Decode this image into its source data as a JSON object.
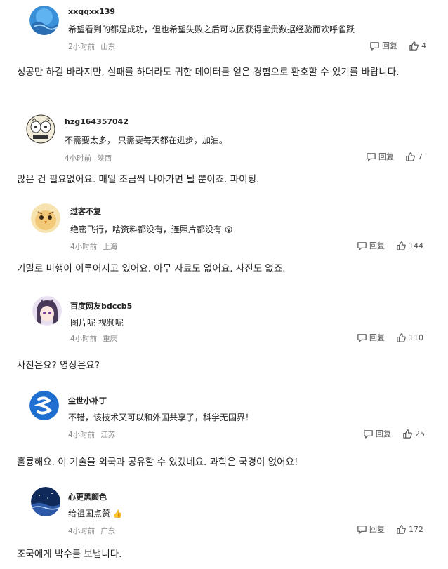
{
  "comments": [
    {
      "username": "xxqqxx139",
      "text": "希望看到的都是成功，但也希望失败之后可以因获得宝贵数据经验而欢呼雀跃",
      "time": "2小时前",
      "location": "山东",
      "reply_label": "回复",
      "likes": "4",
      "translation": "성공만 하길 바라지만, 실패를 하더라도 귀한 데이터를 얻은 경험으로 환호할 수 있기를 바랍니다."
    },
    {
      "username": "hzg164357042",
      "text": "不需要太多， 只需要每天都在进步，加油。",
      "time": "4小时前",
      "location": "陕西",
      "reply_label": "回复",
      "likes": "7",
      "translation": "많은 건 필요없어요. 매일 조금씩 나아가면 될 뿐이죠. 파이팅."
    },
    {
      "username": "过客不复",
      "text": "绝密飞行，啥资料都没有，连照片都没有",
      "emoji": "😮",
      "time": "4小时前",
      "location": "上海",
      "reply_label": "回复",
      "likes": "144",
      "translation": "기밀로 비행이 이루어지고 있어요. 아무 자료도 없어요. 사진도 없죠."
    },
    {
      "username": "百度网友bdccb5",
      "text": "图片呢 视频呢",
      "time": "4小时前",
      "location": "重庆",
      "reply_label": "回复",
      "likes": "110",
      "translation": "사진은요? 영상은요?"
    },
    {
      "username": "尘世小补丁",
      "text": "不错，该技术又可以和外国共享了，科学无国界！",
      "time": "4小时前",
      "location": "江苏",
      "reply_label": "回复",
      "likes": "25",
      "translation": "훌륭해요. 이 기술을 외국과 공유할 수 있겠네요. 과학은 국경이 없어요!"
    },
    {
      "username": "心更黑颜色",
      "text": "给祖国点赞",
      "emoji": "👍",
      "time": "4小时前",
      "location": "广东",
      "reply_label": "回复",
      "likes": "172",
      "translation": "조국에게 박수를 보냅니다."
    }
  ]
}
